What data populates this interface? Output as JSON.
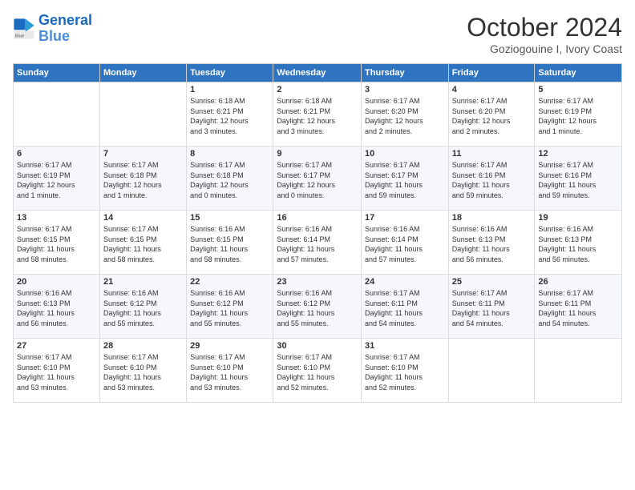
{
  "header": {
    "logo_line1": "General",
    "logo_line2": "Blue",
    "month_title": "October 2024",
    "subtitle": "Goziogouine I, Ivory Coast"
  },
  "days_of_week": [
    "Sunday",
    "Monday",
    "Tuesday",
    "Wednesday",
    "Thursday",
    "Friday",
    "Saturday"
  ],
  "weeks": [
    [
      {
        "day": "",
        "info": ""
      },
      {
        "day": "",
        "info": ""
      },
      {
        "day": "1",
        "info": "Sunrise: 6:18 AM\nSunset: 6:21 PM\nDaylight: 12 hours\nand 3 minutes."
      },
      {
        "day": "2",
        "info": "Sunrise: 6:18 AM\nSunset: 6:21 PM\nDaylight: 12 hours\nand 3 minutes."
      },
      {
        "day": "3",
        "info": "Sunrise: 6:17 AM\nSunset: 6:20 PM\nDaylight: 12 hours\nand 2 minutes."
      },
      {
        "day": "4",
        "info": "Sunrise: 6:17 AM\nSunset: 6:20 PM\nDaylight: 12 hours\nand 2 minutes."
      },
      {
        "day": "5",
        "info": "Sunrise: 6:17 AM\nSunset: 6:19 PM\nDaylight: 12 hours\nand 1 minute."
      }
    ],
    [
      {
        "day": "6",
        "info": "Sunrise: 6:17 AM\nSunset: 6:19 PM\nDaylight: 12 hours\nand 1 minute."
      },
      {
        "day": "7",
        "info": "Sunrise: 6:17 AM\nSunset: 6:18 PM\nDaylight: 12 hours\nand 1 minute."
      },
      {
        "day": "8",
        "info": "Sunrise: 6:17 AM\nSunset: 6:18 PM\nDaylight: 12 hours\nand 0 minutes."
      },
      {
        "day": "9",
        "info": "Sunrise: 6:17 AM\nSunset: 6:17 PM\nDaylight: 12 hours\nand 0 minutes."
      },
      {
        "day": "10",
        "info": "Sunrise: 6:17 AM\nSunset: 6:17 PM\nDaylight: 11 hours\nand 59 minutes."
      },
      {
        "day": "11",
        "info": "Sunrise: 6:17 AM\nSunset: 6:16 PM\nDaylight: 11 hours\nand 59 minutes."
      },
      {
        "day": "12",
        "info": "Sunrise: 6:17 AM\nSunset: 6:16 PM\nDaylight: 11 hours\nand 59 minutes."
      }
    ],
    [
      {
        "day": "13",
        "info": "Sunrise: 6:17 AM\nSunset: 6:15 PM\nDaylight: 11 hours\nand 58 minutes."
      },
      {
        "day": "14",
        "info": "Sunrise: 6:17 AM\nSunset: 6:15 PM\nDaylight: 11 hours\nand 58 minutes."
      },
      {
        "day": "15",
        "info": "Sunrise: 6:16 AM\nSunset: 6:15 PM\nDaylight: 11 hours\nand 58 minutes."
      },
      {
        "day": "16",
        "info": "Sunrise: 6:16 AM\nSunset: 6:14 PM\nDaylight: 11 hours\nand 57 minutes."
      },
      {
        "day": "17",
        "info": "Sunrise: 6:16 AM\nSunset: 6:14 PM\nDaylight: 11 hours\nand 57 minutes."
      },
      {
        "day": "18",
        "info": "Sunrise: 6:16 AM\nSunset: 6:13 PM\nDaylight: 11 hours\nand 56 minutes."
      },
      {
        "day": "19",
        "info": "Sunrise: 6:16 AM\nSunset: 6:13 PM\nDaylight: 11 hours\nand 56 minutes."
      }
    ],
    [
      {
        "day": "20",
        "info": "Sunrise: 6:16 AM\nSunset: 6:13 PM\nDaylight: 11 hours\nand 56 minutes."
      },
      {
        "day": "21",
        "info": "Sunrise: 6:16 AM\nSunset: 6:12 PM\nDaylight: 11 hours\nand 55 minutes."
      },
      {
        "day": "22",
        "info": "Sunrise: 6:16 AM\nSunset: 6:12 PM\nDaylight: 11 hours\nand 55 minutes."
      },
      {
        "day": "23",
        "info": "Sunrise: 6:16 AM\nSunset: 6:12 PM\nDaylight: 11 hours\nand 55 minutes."
      },
      {
        "day": "24",
        "info": "Sunrise: 6:17 AM\nSunset: 6:11 PM\nDaylight: 11 hours\nand 54 minutes."
      },
      {
        "day": "25",
        "info": "Sunrise: 6:17 AM\nSunset: 6:11 PM\nDaylight: 11 hours\nand 54 minutes."
      },
      {
        "day": "26",
        "info": "Sunrise: 6:17 AM\nSunset: 6:11 PM\nDaylight: 11 hours\nand 54 minutes."
      }
    ],
    [
      {
        "day": "27",
        "info": "Sunrise: 6:17 AM\nSunset: 6:10 PM\nDaylight: 11 hours\nand 53 minutes."
      },
      {
        "day": "28",
        "info": "Sunrise: 6:17 AM\nSunset: 6:10 PM\nDaylight: 11 hours\nand 53 minutes."
      },
      {
        "day": "29",
        "info": "Sunrise: 6:17 AM\nSunset: 6:10 PM\nDaylight: 11 hours\nand 53 minutes."
      },
      {
        "day": "30",
        "info": "Sunrise: 6:17 AM\nSunset: 6:10 PM\nDaylight: 11 hours\nand 52 minutes."
      },
      {
        "day": "31",
        "info": "Sunrise: 6:17 AM\nSunset: 6:10 PM\nDaylight: 11 hours\nand 52 minutes."
      },
      {
        "day": "",
        "info": ""
      },
      {
        "day": "",
        "info": ""
      }
    ]
  ]
}
